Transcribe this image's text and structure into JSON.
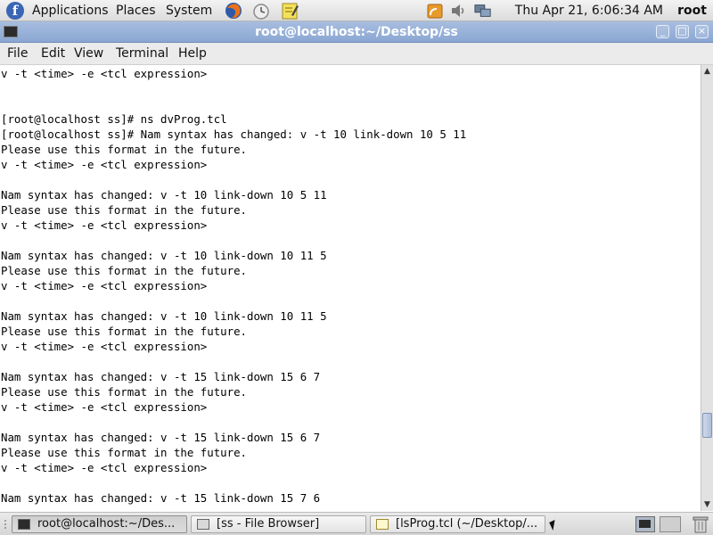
{
  "top_panel": {
    "menus": [
      "Applications",
      "Places",
      "System"
    ],
    "clock": "Thu Apr 21,  6:06:34 AM",
    "user": "root"
  },
  "window": {
    "title": "root@localhost:~/Desktop/ss",
    "controls": [
      "minimize",
      "maximize",
      "close"
    ]
  },
  "menubar": [
    "File",
    "Edit",
    "View",
    "Terminal",
    "Help"
  ],
  "terminal_lines": [
    "v -t <time> -e <tcl expression>",
    "",
    "",
    "[root@localhost ss]# ns dvProg.tcl",
    "[root@localhost ss]# Nam syntax has changed: v -t 10 link-down 10 5 11",
    "Please use this format in the future.",
    "v -t <time> -e <tcl expression>",
    "",
    "Nam syntax has changed: v -t 10 link-down 10 5 11",
    "Please use this format in the future.",
    "v -t <time> -e <tcl expression>",
    "",
    "Nam syntax has changed: v -t 10 link-down 10 11 5",
    "Please use this format in the future.",
    "v -t <time> -e <tcl expression>",
    "",
    "Nam syntax has changed: v -t 10 link-down 10 11 5",
    "Please use this format in the future.",
    "v -t <time> -e <tcl expression>",
    "",
    "Nam syntax has changed: v -t 15 link-down 15 6 7",
    "Please use this format in the future.",
    "v -t <time> -e <tcl expression>",
    "",
    "Nam syntax has changed: v -t 15 link-down 15 6 7",
    "Please use this format in the future.",
    "v -t <time> -e <tcl expression>",
    "",
    "Nam syntax has changed: v -t 15 link-down 15 7 6"
  ],
  "taskbar": [
    {
      "label": "root@localhost:~/Des...",
      "icon": "terminal-icon",
      "active": true
    },
    {
      "label": "[ss - File Browser]",
      "icon": "folder-icon",
      "active": false
    },
    {
      "label": "[lsProg.tcl (~/Desktop/...",
      "icon": "text-editor-icon",
      "active": false
    }
  ],
  "colors": {
    "titlebar": "#8aa6d2",
    "panel": "#dcdcdc",
    "terminal_bg": "#ffffff",
    "terminal_fg": "#000000"
  }
}
